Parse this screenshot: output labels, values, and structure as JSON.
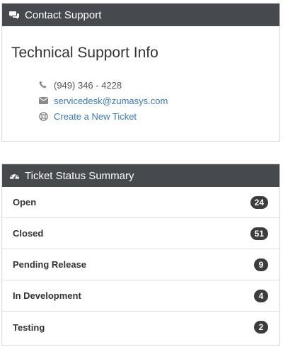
{
  "contact_panel": {
    "header": "Contact Support",
    "header_icon": "comments-icon",
    "title": "Technical Support Info",
    "phone": "(949) 346 - 4228",
    "phone_icon": "phone-icon",
    "email": "servicedesk@zumasys.com",
    "email_icon": "envelope-icon",
    "ticket_link": "Create a New Ticket",
    "ticket_icon": "lifebuoy-icon"
  },
  "status_panel": {
    "header": "Ticket Status Summary",
    "header_icon": "dashboard-icon",
    "items": [
      {
        "label": "Open",
        "count": "24"
      },
      {
        "label": "Closed",
        "count": "51"
      },
      {
        "label": "Pending Release",
        "count": "9"
      },
      {
        "label": "In Development",
        "count": "4"
      },
      {
        "label": "Testing",
        "count": "2"
      }
    ]
  },
  "colors": {
    "header_bg": "#464a4f",
    "link": "#3a7ab5",
    "badge_bg": "#3c3c3c"
  }
}
